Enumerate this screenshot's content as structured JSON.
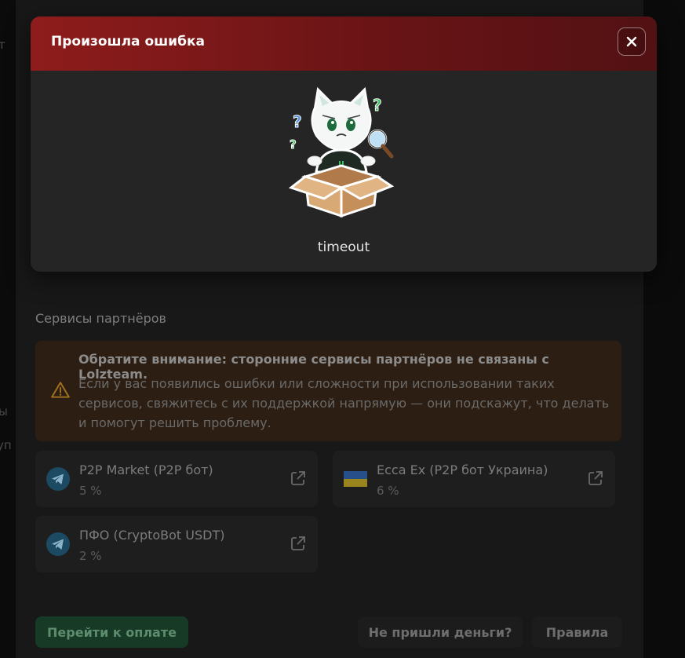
{
  "modal": {
    "title": "Произошла ошибка",
    "message": "timeout",
    "close_icon": "close-icon",
    "header_color": "#8e1c1c"
  },
  "partners_section": {
    "title": "Сервисы партнёров",
    "notice": {
      "title": "Обратите внимание: сторонние сервисы партнёров не связаны с Lolzteam.",
      "body": "Если у вас появились ошибки или сложности при использовании таких сервисов, свяжитесь с их поддержкой напрямую — они подскажут, что делать и помогут решить проблему.",
      "icon": "warning-icon"
    },
    "partners": [
      {
        "name": "P2P Market (P2P бот)",
        "fee": "5 %",
        "icon": "telegram-icon"
      },
      {
        "name": "Ecca Ex (P2P бот Украина)",
        "fee": "6 %",
        "icon": "ukraine-flag-icon"
      },
      {
        "name": "ПФО (CryptoBot USDT)",
        "fee": "2 %",
        "icon": "telegram-icon"
      }
    ]
  },
  "footer": {
    "pay_button": "Перейти к оплате",
    "no_money_button": "Не пришли деньги?",
    "rules_button": "Правила"
  }
}
